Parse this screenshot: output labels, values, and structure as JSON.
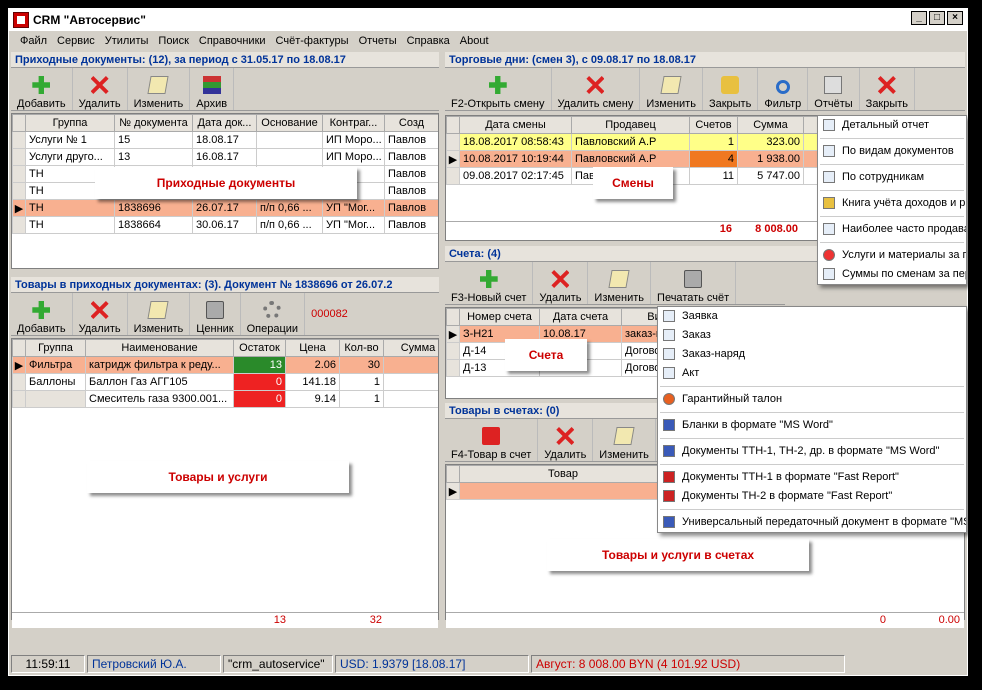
{
  "window": {
    "title": "CRM \"Автосервис\"",
    "buttons": [
      "_",
      "□",
      "×"
    ]
  },
  "menu": [
    "Файл",
    "Сервис",
    "Утилиты",
    "Поиск",
    "Справочники",
    "Счёт-фактуры",
    "Отчеты",
    "Справка",
    "About"
  ],
  "incoming": {
    "title": "Приходные документы: (12), за период с 31.05.17 по 18.08.17",
    "toolbar": [
      "Добавить",
      "Удалить",
      "Изменить",
      "Архив"
    ],
    "columns": [
      "Группа",
      "№ документа",
      "Дата док...",
      "Основание",
      "Контраг...",
      "Созд"
    ],
    "rows": [
      [
        "Услуги № 1",
        "15",
        "18.08.17",
        "",
        "ИП Моро...",
        "Павлов"
      ],
      [
        "Услуги друго...",
        "13",
        "16.08.17",
        "",
        "ИП Моро...",
        "Павлов"
      ],
      [
        "ТН",
        "",
        "",
        "",
        "",
        "Павлов"
      ],
      [
        "ТН",
        "",
        "",
        "",
        "",
        "Павлов"
      ],
      [
        "ТН",
        "1838696",
        "26.07.17",
        "п/п 0,66 ...",
        "УП \"Мог...",
        "Павлов"
      ],
      [
        "ТН",
        "1838664",
        "30.06.17",
        "п/п 0,66 ...",
        "УП \"Мог...",
        "Павлов"
      ]
    ],
    "overlay_label": "Приходные документы"
  },
  "goods": {
    "title": "Товары в приходных документах: (3). Документ № 1838696 от 26.07.2",
    "toolbar": [
      "Добавить",
      "Удалить",
      "Изменить",
      "Ценник",
      "Операции"
    ],
    "code": "000082",
    "columns": [
      "Группа",
      "Наименование",
      "Остаток",
      "Цена",
      "Кол-во",
      "Сумма"
    ],
    "rows": [
      [
        "Фильтра",
        "катридж фильтра к реду...",
        "13",
        "2.06",
        "30",
        ""
      ],
      [
        "Баллоны",
        "Баллон Газ АГГ105",
        "0",
        "141.18",
        "1",
        ""
      ],
      [
        "",
        "Смеситель газа 9300.001...",
        "0",
        "9.14",
        "1",
        ""
      ]
    ],
    "totals": {
      "stock": "13",
      "qty": "32"
    },
    "overlay_label": "Товары и услуги"
  },
  "shifts": {
    "title": "Торговые дни: (смен 3), с 09.08.17 по 18.08.17",
    "toolbar": [
      "F2-Открыть смену",
      "Удалить смену",
      "Изменить",
      "Закрыть",
      "Фильтр",
      "Отчёты",
      "Закрыть"
    ],
    "columns": [
      "Дата смены",
      "Продавец",
      "Счетов",
      "Сумма"
    ],
    "rows": [
      [
        "18.08.2017 08:58:43",
        "Павловский А.Р",
        "1",
        "323.00"
      ],
      [
        "10.08.2017 10:19:44",
        "Павловский А.Р",
        "4",
        "1 938.00"
      ],
      [
        "09.08.2017 02:17:45",
        "Павловский А.Р",
        "11",
        "5 747.00"
      ]
    ],
    "totals": {
      "count": "16",
      "sum": "8 008.00"
    },
    "overlay_label": "Смены"
  },
  "reports_menu": [
    "Детальный отчет",
    "По видам документов",
    "По сотрудникам",
    "Книга учёта доходов и р",
    "Наиболее часто продава",
    "Услуги и материалы за по",
    "Суммы по сменам за пери"
  ],
  "invoices": {
    "title": "Счета: (4)",
    "toolbar": [
      "F3-Новый счет",
      "Удалить",
      "Изменить",
      "Печатать счёт"
    ],
    "columns": [
      "Номер счета",
      "Дата счета",
      "Ви"
    ],
    "rows": [
      [
        "З-Н21",
        "10.08.17",
        "заказ-н"
      ],
      [
        "Д-14",
        "10.08.17",
        "Догово"
      ],
      [
        "Д-13",
        "10.08.17",
        "Догово"
      ]
    ],
    "overlay_label": "Счета"
  },
  "print_menu": [
    "Заявка",
    "Заказ",
    "Заказ-наряд",
    "Акт",
    "Гарантийный талон",
    "Бланки в формате \"MS Word\"",
    "Документы ТТН-1, ТН-2, др. в формате \"MS Word\"",
    "Документы ТТН-1 в формате \"Fast Report\"",
    "Документы ТН-2 в формате \"Fast Report\"",
    "Универсальный передаточный документ в формате \"MS"
  ],
  "invoice_goods": {
    "title": "Товары в счетах: (0)",
    "toolbar": [
      "F4-Товар в счет",
      "Удалить",
      "Изменить"
    ],
    "columns": [
      "Товар"
    ],
    "totals": {
      "a": "0",
      "b": "0.00"
    },
    "overlay_label": "Товары и услуги в счетах"
  },
  "status": {
    "time": "11:59:11",
    "user": "Петровский Ю.А.",
    "db": "\"crm_autoservice\"",
    "rate": "USD: 1.9379 [18.08.17]",
    "month": "Август: 8 008.00 BYN (4 101.92 USD)"
  },
  "colors": {
    "title_blue": "#003399",
    "red": "#cc0000",
    "sel": "#f8b090",
    "yellow": "#ffff88",
    "green_cell": "#2a8a2a",
    "red_cell": "#ee2222"
  }
}
